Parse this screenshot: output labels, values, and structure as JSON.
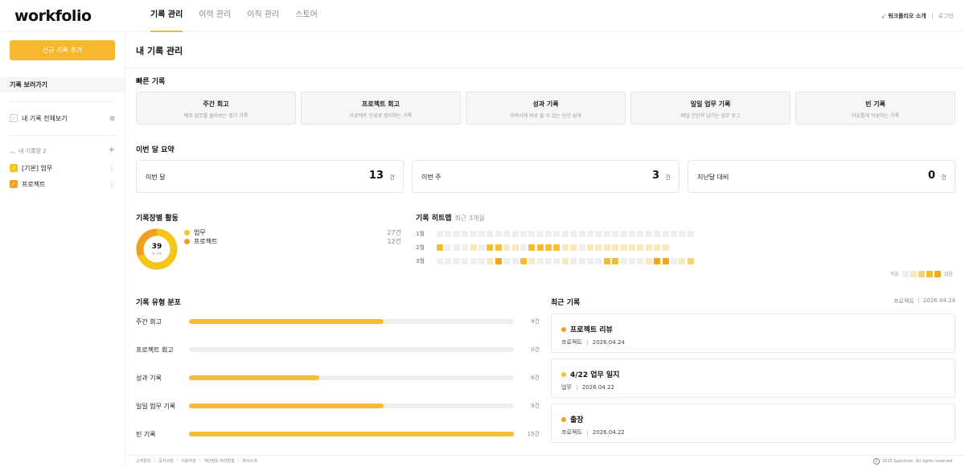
{
  "header": {
    "logo": "workfolio",
    "nav": [
      "기록 관리",
      "이력 관리",
      "이직 관리",
      "스토어"
    ],
    "intro_icon": "rocket-icon",
    "intro": "워크폴리오 소개",
    "login": "로그인"
  },
  "sidebar": {
    "new_button": "신규 기록 추가",
    "section": "기록 보러가기",
    "all_view": "내 기록 전체보기",
    "group_title": "내 기록장 2",
    "books": [
      {
        "label": "[기본] 업무",
        "color": "#f5c518"
      },
      {
        "label": "프로젝트",
        "color": "#f0a020"
      }
    ]
  },
  "main": {
    "title": "내 기록 관리",
    "quick": {
      "title": "빠른 기록",
      "cards": [
        {
          "title": "주간 회고",
          "desc": "매주 업무를 돌아보는 정기 기록"
        },
        {
          "title": "프로젝트 회고",
          "desc": "프로젝트 단위로 정리하는 기록"
        },
        {
          "title": "성과 기록",
          "desc": "이력서에 바로 쓸 수 있는 단건 성과"
        },
        {
          "title": "일일 업무 기록",
          "desc": "매일 간단히 남기는 업무 로그"
        },
        {
          "title": "빈 기록",
          "desc": "자유롭게 작성하는 기록"
        }
      ]
    },
    "summary": {
      "title": "이번 달 요약",
      "unit": "건",
      "cards": [
        {
          "label": "이번 달",
          "value": "13"
        },
        {
          "label": "이번 주",
          "value": "3"
        },
        {
          "label": "지난달 대비",
          "value": "0"
        }
      ]
    },
    "activity": {
      "title": "기록장별 활동",
      "total": "39",
      "total_label": "총 기록",
      "items": [
        {
          "name": "업무",
          "count": "27건",
          "value": 27,
          "color": "#f5c518"
        },
        {
          "name": "프로젝트",
          "count": "12건",
          "value": 12,
          "color": "#f0a020"
        }
      ]
    },
    "heatmap": {
      "title": "기록 히트맵",
      "subtitle": "최근 3개월",
      "months": [
        {
          "label": "1월",
          "levels": [
            0,
            0,
            0,
            0,
            0,
            0,
            0,
            0,
            0,
            0,
            0,
            0,
            0,
            0,
            0,
            0,
            0,
            0,
            0,
            0,
            0,
            0,
            0,
            0,
            0,
            0,
            0,
            0,
            0,
            0,
            0
          ]
        },
        {
          "label": "2월",
          "levels": [
            3,
            0,
            0,
            0,
            1,
            0,
            3,
            3,
            1,
            1,
            0,
            3,
            3,
            3,
            3,
            1,
            1,
            0,
            1,
            1,
            1,
            1,
            1,
            1,
            1,
            1,
            1,
            1
          ]
        },
        {
          "label": "3월",
          "levels": [
            0,
            0,
            0,
            0,
            0,
            0,
            1,
            4,
            0,
            0,
            3,
            1,
            0,
            0,
            0,
            1,
            0,
            0,
            0,
            0,
            3,
            3,
            0,
            0,
            0,
            1,
            4,
            4,
            0,
            1,
            2
          ]
        }
      ],
      "legend_low": "적음",
      "legend_high": "많음",
      "legend_levels": [
        0,
        1,
        2,
        3,
        4
      ]
    },
    "distribution": {
      "title": "기록 유형 분포",
      "max": 15,
      "rows": [
        {
          "label": "주간 회고",
          "value": 9,
          "count": "9건"
        },
        {
          "label": "프로젝트 회고",
          "value": 0,
          "count": "0건"
        },
        {
          "label": "성과 기록",
          "value": 6,
          "count": "6건"
        },
        {
          "label": "일일 업무 기록",
          "value": 9,
          "count": "9건"
        },
        {
          "label": "빈 기록",
          "value": 15,
          "count": "15건"
        }
      ]
    },
    "recent": {
      "title": "최근 기록",
      "meta_book": "프로젝트",
      "meta_date": "2026.04.24",
      "items": [
        {
          "title": "프로젝트 리뷰",
          "book": "프로젝트",
          "date": "2026.04.24",
          "color": "#f0a020"
        },
        {
          "title": "4/22 업무 일지",
          "book": "업무",
          "date": "2026.04.22",
          "color": "#f5c518"
        },
        {
          "title": "출장",
          "book": "프로젝트",
          "date": "2026.04.22",
          "color": "#f0a020"
        }
      ]
    }
  },
  "footer": {
    "links": [
      "고객문의",
      "공지사항",
      "이용약관",
      "개인정보 처리방침",
      "회사소개"
    ],
    "copyright": "2025 Spectrum. All rights reserved."
  }
}
